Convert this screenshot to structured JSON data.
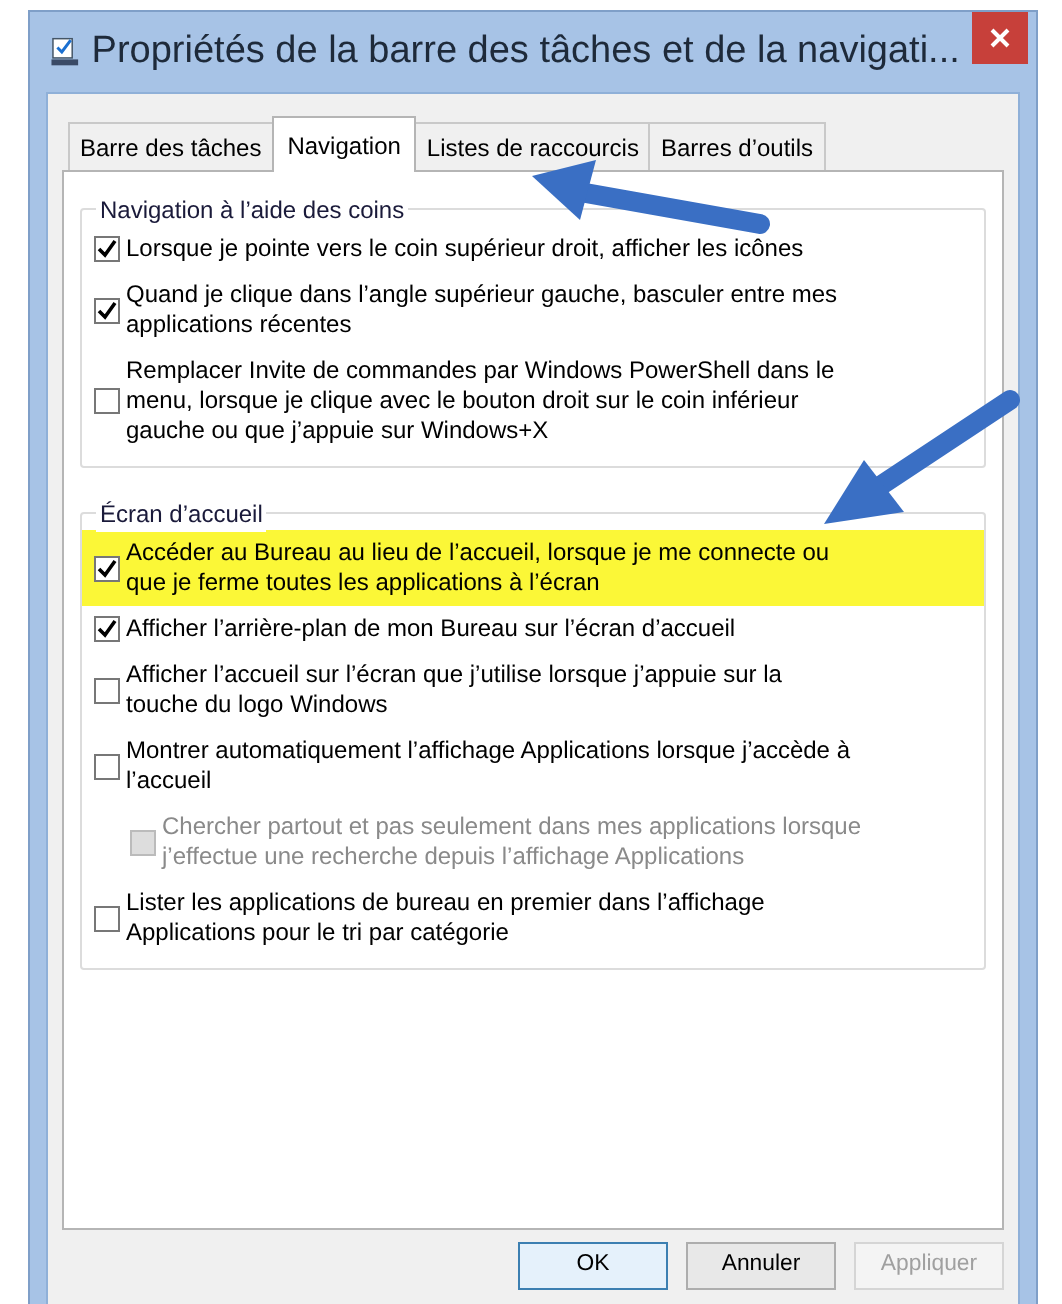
{
  "window": {
    "title": "Propriétés de la barre des tâches et de la navigati..."
  },
  "tabs": [
    {
      "label": "Barre des tâches",
      "selected": false
    },
    {
      "label": "Navigation",
      "selected": true
    },
    {
      "label": "Listes de raccourcis",
      "selected": false
    },
    {
      "label": "Barres d’outils",
      "selected": false
    }
  ],
  "groups": [
    {
      "title": "Navigation à l’aide des coins",
      "options": [
        {
          "label": "Lorsque je pointe vers le coin supérieur droit, afficher les icônes",
          "checked": true,
          "disabled": false,
          "highlighted": false
        },
        {
          "label": "Quand je clique dans l’angle supérieur gauche, basculer entre mes applications récentes",
          "checked": true,
          "disabled": false,
          "highlighted": false
        },
        {
          "label": "Remplacer Invite de commandes par Windows PowerShell dans le menu, lorsque je clique avec le bouton droit sur le coin inférieur gauche ou que j’appuie sur Windows+X",
          "checked": false,
          "disabled": false,
          "highlighted": false
        }
      ]
    },
    {
      "title": "Écran d’accueil",
      "options": [
        {
          "label": "Accéder au Bureau au lieu de l’accueil, lorsque je me connecte ou que je ferme toutes les applications à l’écran",
          "checked": true,
          "disabled": false,
          "highlighted": true
        },
        {
          "label": "Afficher l’arrière-plan de mon Bureau sur l’écran d’accueil",
          "checked": true,
          "disabled": false,
          "highlighted": false
        },
        {
          "label": "Afficher l’accueil sur l’écran que j’utilise lorsque j’appuie sur la touche du logo Windows",
          "checked": false,
          "disabled": false,
          "highlighted": false
        },
        {
          "label": "Montrer automatiquement l’affichage Applications lorsque j’accède à l’accueil",
          "checked": false,
          "disabled": false,
          "highlighted": false,
          "children": [
            {
              "label": "Chercher partout et pas seulement dans mes applications lorsque j’effectue une recherche depuis l’affichage Applications",
              "checked": false,
              "disabled": true,
              "highlighted": false
            }
          ]
        },
        {
          "label": "Lister les applications de bureau en premier dans l’affichage Applications pour le tri par catégorie",
          "checked": false,
          "disabled": false,
          "highlighted": false
        }
      ]
    }
  ],
  "buttons": [
    {
      "label": "OK",
      "default": true,
      "disabled": false
    },
    {
      "label": "Annuler",
      "default": false,
      "disabled": false
    },
    {
      "label": "Appliquer",
      "default": false,
      "disabled": true
    }
  ]
}
